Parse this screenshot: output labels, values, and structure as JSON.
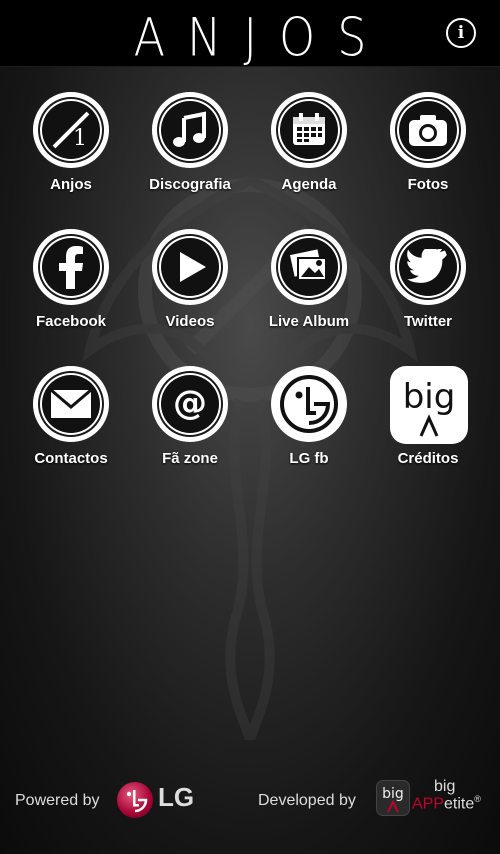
{
  "header": {
    "title": "ANJOS",
    "info_label": "i"
  },
  "tiles": [
    {
      "label": "Anjos",
      "icon": "anjos-logo-icon"
    },
    {
      "label": "Discografia",
      "icon": "music-note-icon"
    },
    {
      "label": "Agenda",
      "icon": "calendar-icon"
    },
    {
      "label": "Fotos",
      "icon": "camera-icon"
    },
    {
      "label": "Facebook",
      "icon": "facebook-icon"
    },
    {
      "label": "Videos",
      "icon": "play-icon"
    },
    {
      "label": "Live Album",
      "icon": "photo-album-icon"
    },
    {
      "label": "Twitter",
      "icon": "twitter-bird-icon"
    },
    {
      "label": "Contactos",
      "icon": "envelope-icon"
    },
    {
      "label": "Fã zone",
      "icon": "at-sign-icon"
    },
    {
      "label": "LG fb",
      "icon": "lg-logo-icon"
    },
    {
      "label": "Créditos",
      "icon": "big-appetite-logo-icon"
    }
  ],
  "footer": {
    "powered_by": "Powered by",
    "lg_text": "LG",
    "developed_by": "Developed by",
    "big_icon_text": "big",
    "big_top": "big",
    "big_app": "APP",
    "big_etite": "etite",
    "big_tm": "®",
    "big_tile_text": "big"
  },
  "colors": {
    "header_bg": "#000000",
    "lg_red": "#a50034",
    "bigappetite_red": "#c0002a"
  }
}
